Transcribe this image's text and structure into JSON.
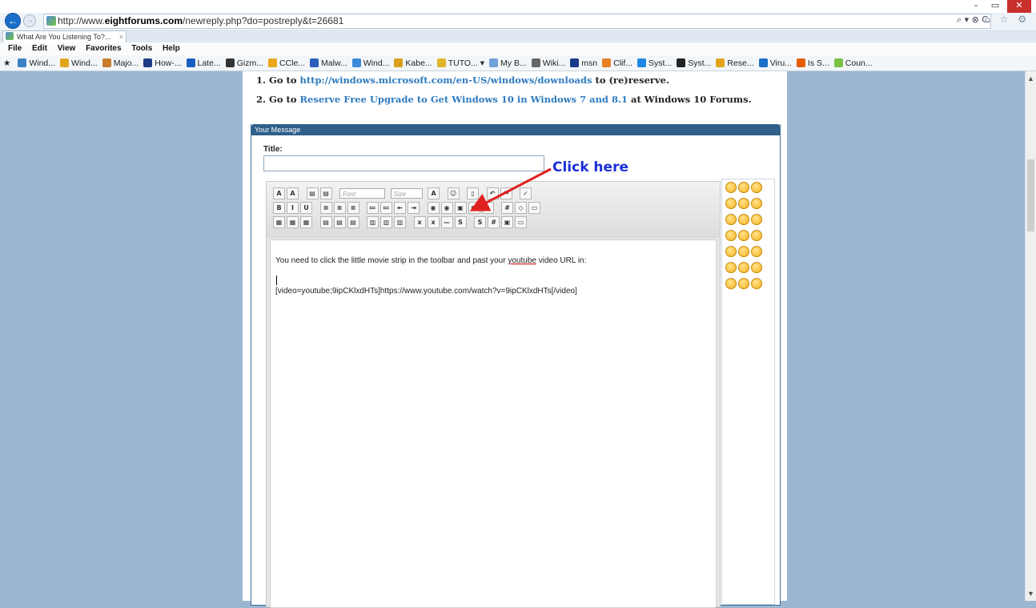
{
  "window": {
    "minimize": "–",
    "restore": "▭",
    "close": "✕"
  },
  "address_bar": {
    "url_prefix": "http://www.",
    "url_domain": "eightforums.com",
    "url_path": "/newreply.php?do=postreply&t=26681",
    "tools": "⌕ ▾ ⊗ C",
    "right_icons": "⌂ ☆ ⚙"
  },
  "tab": {
    "title": "What Are You Listening To?...",
    "close": "×"
  },
  "menu": [
    "File",
    "Edit",
    "View",
    "Favorites",
    "Tools",
    "Help"
  ],
  "favorites": [
    {
      "label": "Wind...",
      "color": "#3b82c4"
    },
    {
      "label": "Wind...",
      "color": "#e0a51b"
    },
    {
      "label": "Majo...",
      "color": "#c77d2a"
    },
    {
      "label": "How-...",
      "color": "#1f3c88"
    },
    {
      "label": "Late...",
      "color": "#1a5fc2"
    },
    {
      "label": "Gizm...",
      "color": "#333333"
    },
    {
      "label": "CCle...",
      "color": "#e8a818"
    },
    {
      "label": "Malw...",
      "color": "#2b5ebd"
    },
    {
      "label": "Wind...",
      "color": "#3d8bd8"
    },
    {
      "label": "Kabe...",
      "color": "#d8a01a"
    },
    {
      "label": "TUTO... ▾",
      "color": "#e0b52a"
    },
    {
      "label": "My B...",
      "color": "#6fa0d8"
    },
    {
      "label": "Wiki...",
      "color": "#666666"
    },
    {
      "label": "msn",
      "color": "#1a3a8a"
    },
    {
      "label": "Clif...",
      "color": "#e67e22"
    },
    {
      "label": "Syst...",
      "color": "#1e88e5"
    },
    {
      "label": "Syst...",
      "color": "#222222"
    },
    {
      "label": "Rese...",
      "color": "#e0a51b"
    },
    {
      "label": "Viru...",
      "color": "#1a6fc9"
    },
    {
      "label": "Is S...",
      "color": "#e65c00"
    },
    {
      "label": "Coun...",
      "color": "#7ac142"
    }
  ],
  "page": {
    "step1_prefix": "1. Go to ",
    "step1_link": "http://windows.microsoft.com/en-US/windows/downloads",
    "step1_suffix": " to (re)reserve.",
    "step2_prefix": "2. Go to ",
    "step2_link": "Reserve Free Upgrade to Get Windows 10 in Windows 7 and 8.1",
    "step2_suffix": " at Windows 10 Forums.",
    "panel_title": "Your Message",
    "title_label": "Title:",
    "title_value": "",
    "font_select": "Font",
    "size_select": "Size",
    "message_line1_a": "You need to  click the little movie strip in the toolbar and past your ",
    "message_line1_u": "youtube",
    "message_line1_b": " video URL in:",
    "message_line2": "[video=youtube;9ipCKlxdHTs]https://www.youtube.com/watch?v=9ipCKlxdHTs[/video]"
  },
  "annotation": {
    "text": "Click here",
    "color": "#1a2fd6",
    "arrow_color": "#e02020"
  }
}
